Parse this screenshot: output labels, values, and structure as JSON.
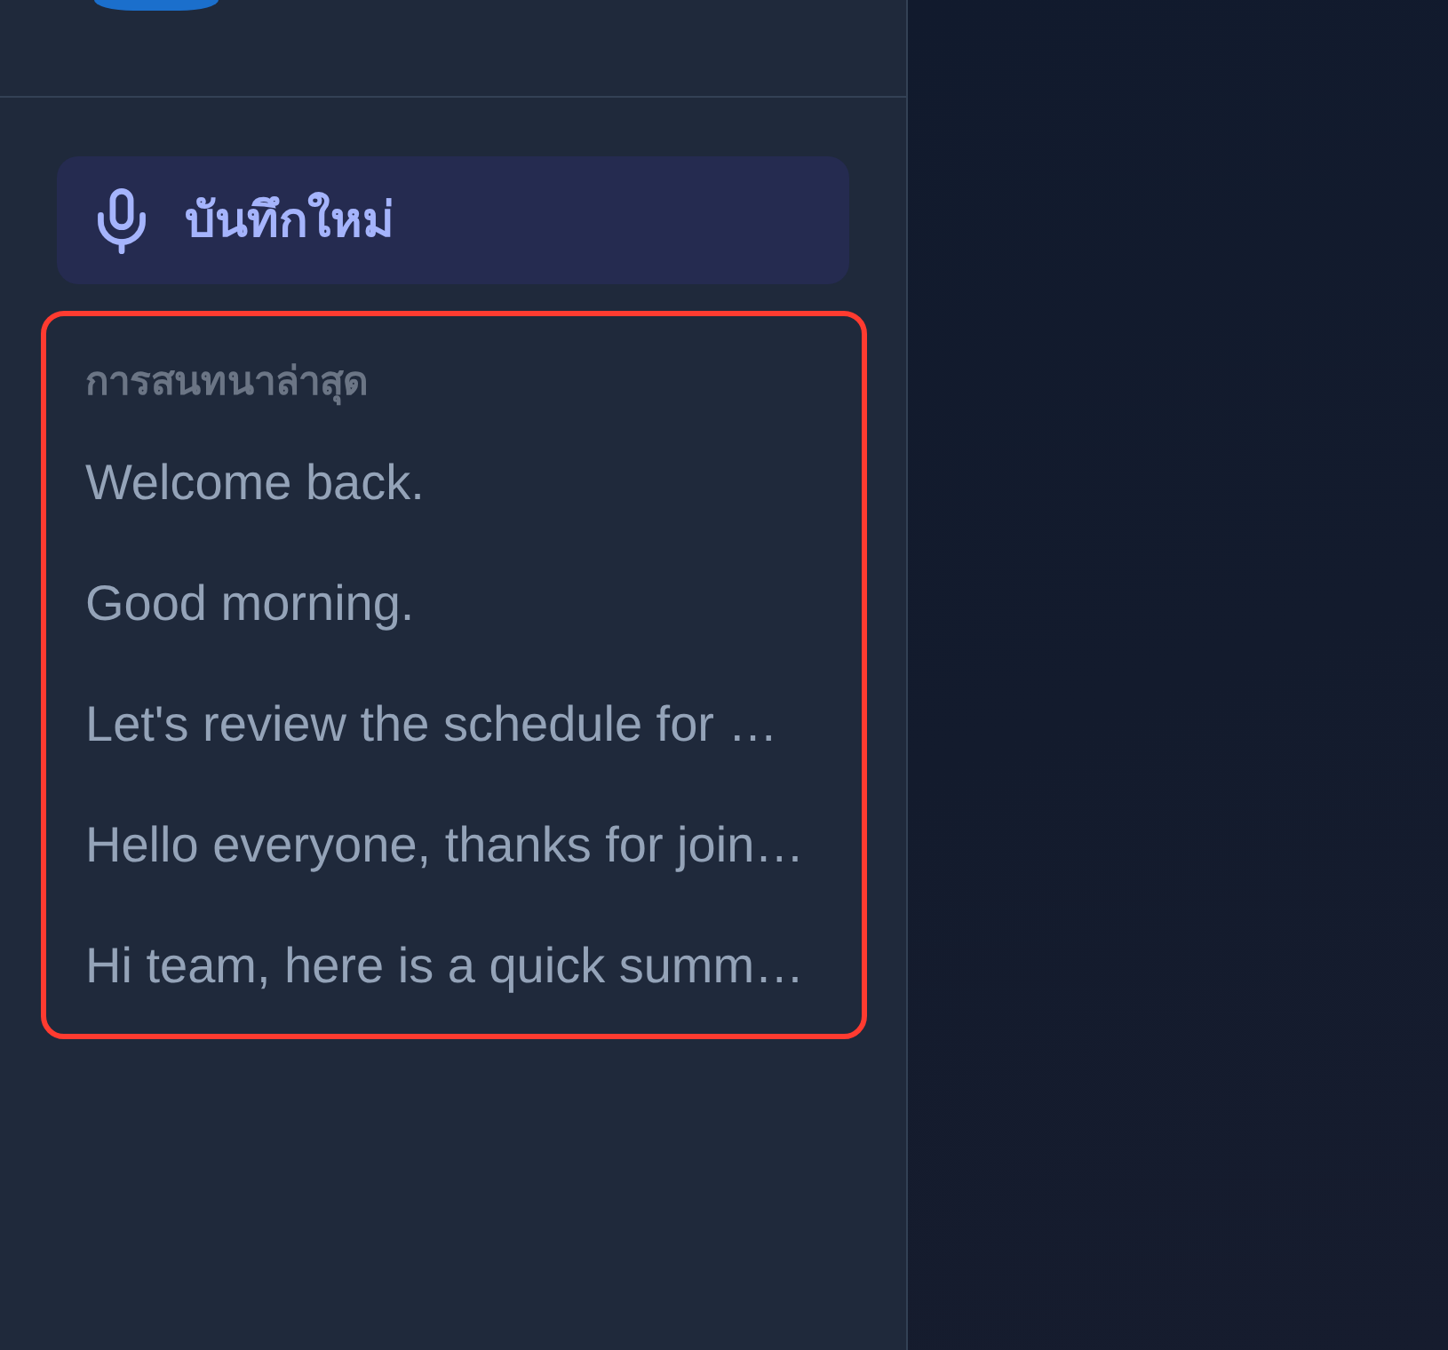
{
  "sidebar": {
    "new_recording_button": {
      "label": "บันทึกใหม่"
    },
    "recent": {
      "highlighted": true,
      "heading": "การสนทนาล่าสุด",
      "items": [
        {
          "title": "Welcome back."
        },
        {
          "title": "Good morning."
        },
        {
          "title": "Let's review the schedule for …"
        },
        {
          "title": "Hello everyone, thanks for join…"
        },
        {
          "title": "Hi team, here is a quick summ…"
        }
      ]
    }
  }
}
